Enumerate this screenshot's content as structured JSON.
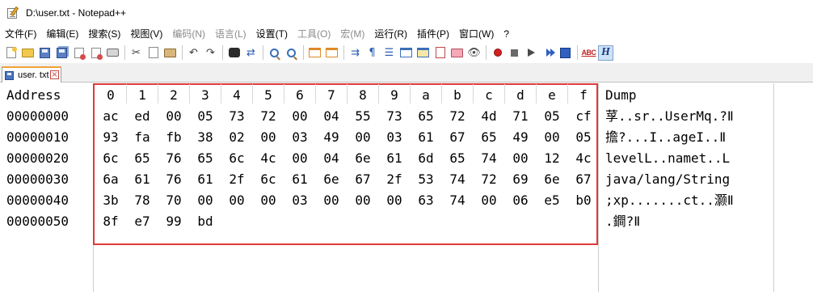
{
  "window": {
    "title": "D:\\user.txt - Notepad++",
    "app_icon": "notepad-plus-plus-icon"
  },
  "menu": [
    "文件(F)",
    "编辑(E)",
    "搜索(S)",
    "视图(V)",
    "编码(N)",
    "语言(L)",
    "设置(T)",
    "工具(O)",
    "宏(M)",
    "运行(R)",
    "插件(P)",
    "窗口(W)",
    "?"
  ],
  "menu_disabled": [
    "编码(N)",
    "语言(L)",
    "工具(O)",
    "宏(M)"
  ],
  "toolbar": {
    "icons": [
      "new-file-icon",
      "open-file-icon",
      "save-icon",
      "save-all-icon",
      "close-icon",
      "close-all-icon",
      "print-icon",
      "cut-icon",
      "copy-icon",
      "paste-icon",
      "undo-icon",
      "redo-icon",
      "find-icon",
      "replace-icon",
      "zoom-in-icon",
      "zoom-out-icon",
      "sync-vertical-icon",
      "sync-horizontal-icon",
      "word-wrap-icon",
      "show-all-chars-icon",
      "indent-guide-icon",
      "doc-map-icon",
      "function-list-icon",
      "folder-workspace-icon",
      "monitoring-icon",
      "record-macro-icon",
      "stop-record-icon",
      "playback-macro-icon",
      "run-macro-multiple-icon",
      "save-macro-icon",
      "spell-check-icon",
      "hex-editor-icon"
    ],
    "spell_check_label": "ABC",
    "hex_editor_label": "H"
  },
  "tab": {
    "label": "user. txt",
    "close_glyph": "×"
  },
  "hex_view": {
    "address_header": "Address",
    "column_headers": [
      "0",
      "1",
      "2",
      "3",
      "4",
      "5",
      "6",
      "7",
      "8",
      "9",
      "a",
      "b",
      "c",
      "d",
      "e",
      "f"
    ],
    "dump_header": "Dump",
    "rows": [
      {
        "address": "00000000",
        "bytes": [
          "ac",
          "ed",
          "00",
          "05",
          "73",
          "72",
          "00",
          "04",
          "55",
          "73",
          "65",
          "72",
          "4d",
          "71",
          "05",
          "cf"
        ],
        "dump": "莩..sr..UserMq.?Ⅱ"
      },
      {
        "address": "00000010",
        "bytes": [
          "93",
          "fa",
          "fb",
          "38",
          "02",
          "00",
          "03",
          "49",
          "00",
          "03",
          "61",
          "67",
          "65",
          "49",
          "00",
          "05"
        ],
        "dump": "擔?...I..ageI..Ⅱ"
      },
      {
        "address": "00000020",
        "bytes": [
          "6c",
          "65",
          "76",
          "65",
          "6c",
          "4c",
          "00",
          "04",
          "6e",
          "61",
          "6d",
          "65",
          "74",
          "00",
          "12",
          "4c"
        ],
        "dump": "levelL..namet..L"
      },
      {
        "address": "00000030",
        "bytes": [
          "6a",
          "61",
          "76",
          "61",
          "2f",
          "6c",
          "61",
          "6e",
          "67",
          "2f",
          "53",
          "74",
          "72",
          "69",
          "6e",
          "67"
        ],
        "dump": "java/lang/String"
      },
      {
        "address": "00000040",
        "bytes": [
          "3b",
          "78",
          "70",
          "00",
          "00",
          "00",
          "03",
          "00",
          "00",
          "00",
          "63",
          "74",
          "00",
          "06",
          "e5",
          "b0"
        ],
        "dump": ";xp.......ct..灏Ⅱ"
      },
      {
        "address": "00000050",
        "bytes": [
          "8f",
          "e7",
          "99",
          "bd"
        ],
        "dump": ".鐧?Ⅱ"
      }
    ]
  },
  "colors": {
    "highlight_border": "#e03a3a",
    "tab_accent": "#f2a236"
  }
}
